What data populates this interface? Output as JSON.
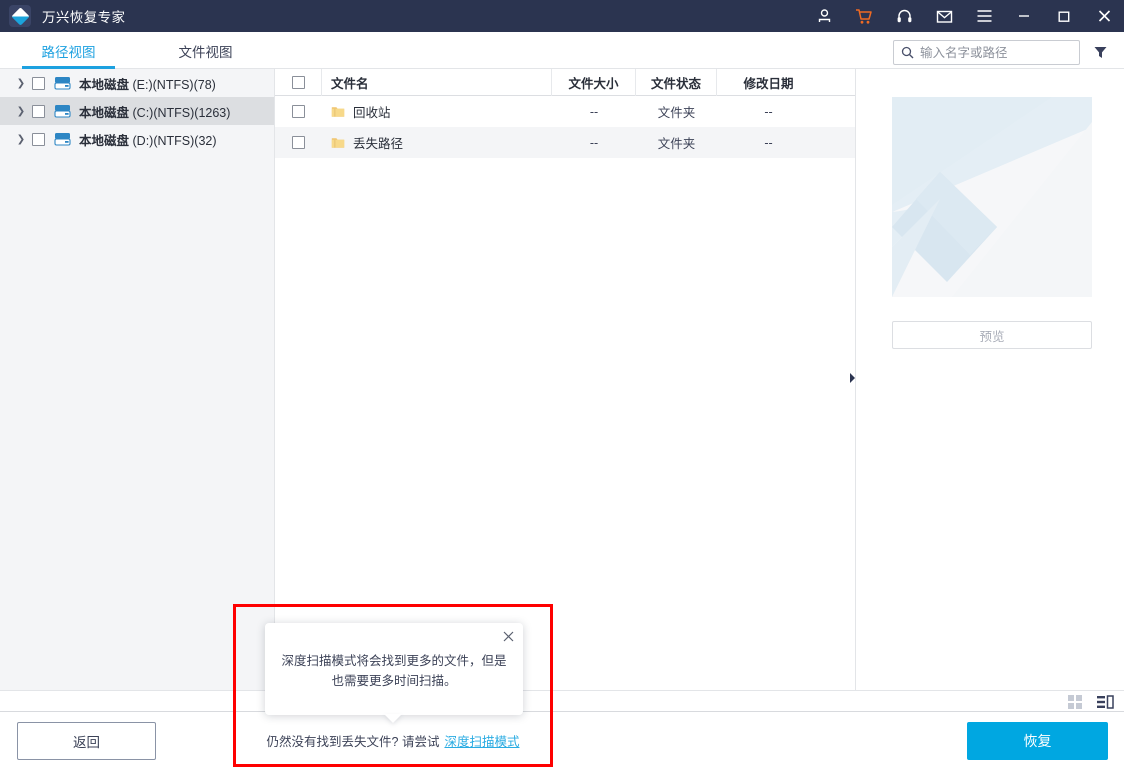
{
  "window": {
    "title": "万兴恢复专家",
    "logo_icon": "wondershare-diamond-logo",
    "controls": [
      {
        "name": "account-icon",
        "glyph": "user"
      },
      {
        "name": "cart-icon",
        "glyph": "cart",
        "color": "#f06a23"
      },
      {
        "name": "support-icon",
        "glyph": "headset"
      },
      {
        "name": "mail-icon",
        "glyph": "mail"
      },
      {
        "name": "menu-icon",
        "glyph": "hamburger"
      },
      {
        "name": "minimize-icon",
        "glyph": "minimize"
      },
      {
        "name": "maximize-icon",
        "glyph": "maximize"
      },
      {
        "name": "close-icon",
        "glyph": "close"
      }
    ]
  },
  "tabs": [
    {
      "label": "路径视图",
      "active": true
    },
    {
      "label": "文件视图",
      "active": false
    }
  ],
  "search": {
    "placeholder": "输入名字或路径",
    "value": "",
    "icon": "search-icon",
    "filter_icon": "filter-funnel-icon"
  },
  "sidebar": {
    "disks": [
      {
        "label_main": "本地磁盘",
        "label_detail": "(E:)(NTFS)(78)",
        "selected": false
      },
      {
        "label_main": "本地磁盘",
        "label_detail": "(C:)(NTFS)(1263)",
        "selected": true
      },
      {
        "label_main": "本地磁盘",
        "label_detail": "(D:)(NTFS)(32)",
        "selected": false
      }
    ]
  },
  "file_table": {
    "columns": [
      "",
      "文件名",
      "文件大小",
      "文件状态",
      "修改日期"
    ],
    "rows": [
      {
        "name": "回收站",
        "size": "--",
        "status": "文件夹",
        "modified": "--"
      },
      {
        "name": "丢失路径",
        "size": "--",
        "status": "文件夹",
        "modified": "--"
      }
    ]
  },
  "preview": {
    "button_label": "预览",
    "placeholder_icon": "image-placeholder"
  },
  "view_toggle": {
    "grid_icon": "grid-view-icon",
    "list_icon": "list-view-icon",
    "active": "list"
  },
  "splitter": {
    "icon": "collapse-panel-arrow-icon"
  },
  "footer": {
    "back_label": "返回",
    "recover_label": "恢复",
    "recover_color": "#00a7e1",
    "hint_text": "仍然没有找到丢失文件? 请尝试",
    "hint_link": "深度扫描模式"
  },
  "tooltip": {
    "message": "深度扫描模式将会找到更多的文件，但是也需要更多时间扫描。",
    "close_icon": "close-icon"
  },
  "annotation": {
    "highlight_color": "#fe0000"
  }
}
